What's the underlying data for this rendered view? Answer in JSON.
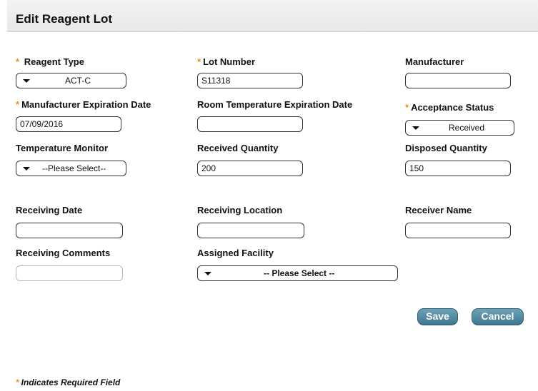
{
  "page": {
    "title": "Edit Reagent Lot"
  },
  "labels": {
    "reagent_type": "Reagent Type",
    "lot_number": "Lot Number",
    "manufacturer": "Manufacturer",
    "mfr_exp_date": "Manufacturer Expiration Date",
    "room_temp_exp_date": "Room Temperature Expiration Date",
    "acceptance_status": "Acceptance Status",
    "temperature_monitor": "Temperature Monitor",
    "received_quantity": "Received Quantity",
    "disposed_quantity": "Disposed Quantity",
    "receiving_date": "Receiving Date",
    "receiving_location": "Receiving Location",
    "receiver_name": "Receiver Name",
    "receiving_comments": "Receiving Comments",
    "assigned_facility": "Assigned Facility"
  },
  "required_marker": "*",
  "values": {
    "reagent_type": "ACT-C",
    "lot_number": "S11318",
    "manufacturer": "",
    "mfr_exp_date": "07/09/2016",
    "room_temp_exp_date": "",
    "acceptance_status": "Received",
    "temperature_monitor": "--Please Select--",
    "received_quantity": "200",
    "disposed_quantity": "150",
    "receiving_date": "",
    "receiving_location": "",
    "receiver_name": "",
    "receiving_comments": "",
    "assigned_facility": "-- Please Select --"
  },
  "buttons": {
    "save": "Save",
    "cancel": "Cancel"
  },
  "footnote": "Indicates Required Field",
  "colors": {
    "required": "#f28c1e",
    "button": "#4f86a0"
  }
}
